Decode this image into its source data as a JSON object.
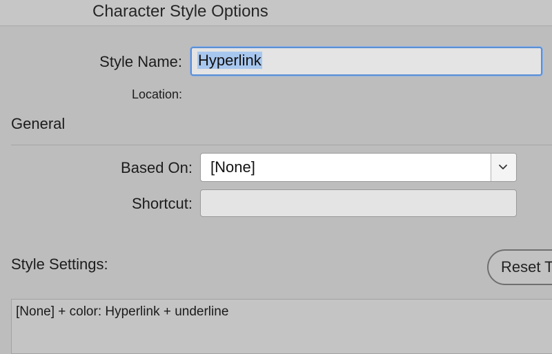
{
  "window": {
    "title": "Character Style Options"
  },
  "form": {
    "style_name_label": "Style Name:",
    "style_name_value": "Hyperlink",
    "location_label": "Location:",
    "location_value": ""
  },
  "general": {
    "heading": "General",
    "based_on_label": "Based On:",
    "based_on_value": "[None]",
    "shortcut_label": "Shortcut:",
    "shortcut_value": ""
  },
  "style_settings": {
    "heading": "Style Settings:",
    "reset_label": "Reset T",
    "description": "[None] + color: Hyperlink + underline"
  },
  "icons": {
    "dropdown": "chevron-down-icon"
  },
  "colors": {
    "focus_ring": "#5b8fd3",
    "selection": "#a8c7ee"
  }
}
